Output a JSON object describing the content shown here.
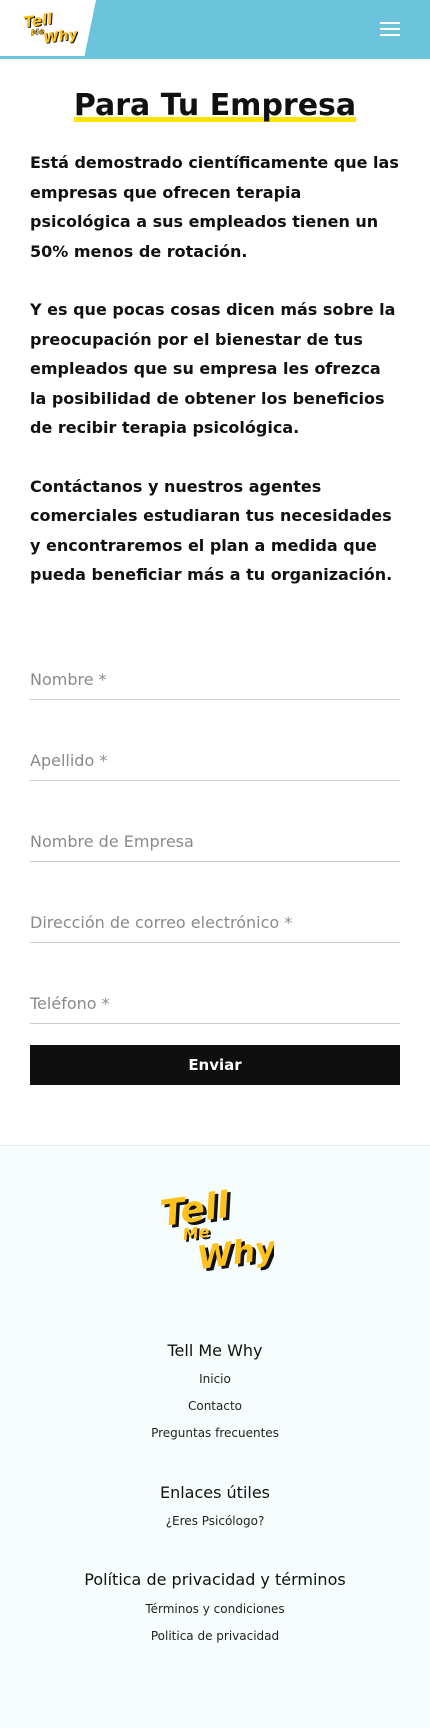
{
  "header": {
    "logo_alt": "Tell Me Why",
    "menu_icon": "hamburger-menu-icon",
    "bg_color": "#6cc3dc"
  },
  "main": {
    "title": "Para Tu Empresa",
    "paragraphs": [
      "Está demostrado científicamente que las empresas que ofrecen terapia psicológica a sus empleados tienen un 50% menos de rotación.",
      "Y es que pocas cosas dicen más sobre la preocupación por el bienestar de tus empleados que su empresa les ofrezca la posibilidad de obtener los beneficios de recibir terapia psicológica.",
      "Contáctanos y nuestros agentes comerciales estudiaran tus necesidades y encontraremos el plan a medida que pueda beneficiar más a tu organización."
    ]
  },
  "form": {
    "fields": [
      {
        "placeholder": "Nombre *",
        "value": ""
      },
      {
        "placeholder": "Apellido *",
        "value": ""
      },
      {
        "placeholder": "Nombre de Empresa",
        "value": ""
      },
      {
        "placeholder": "Dirección de correo electrónico *",
        "value": ""
      },
      {
        "placeholder": "Teléfono *",
        "value": ""
      }
    ],
    "submit_label": "Enviar"
  },
  "footer": {
    "sections": [
      {
        "title": "Tell Me Why",
        "links": [
          "Inicio",
          "Contacto",
          "Preguntas frecuentes"
        ]
      },
      {
        "title": "Enlaces útiles",
        "links": [
          "¿Eres Psicólogo?"
        ]
      },
      {
        "title": "Política de privacidad y términos",
        "links": [
          "Términos y condiciones",
          "Politica de privacidad"
        ]
      }
    ]
  },
  "colors": {
    "accent_yellow": "#ffe400",
    "header_blue": "#6cc3dc",
    "button_black": "#0f0f0f",
    "footer_bg": "#f5fdfd"
  }
}
